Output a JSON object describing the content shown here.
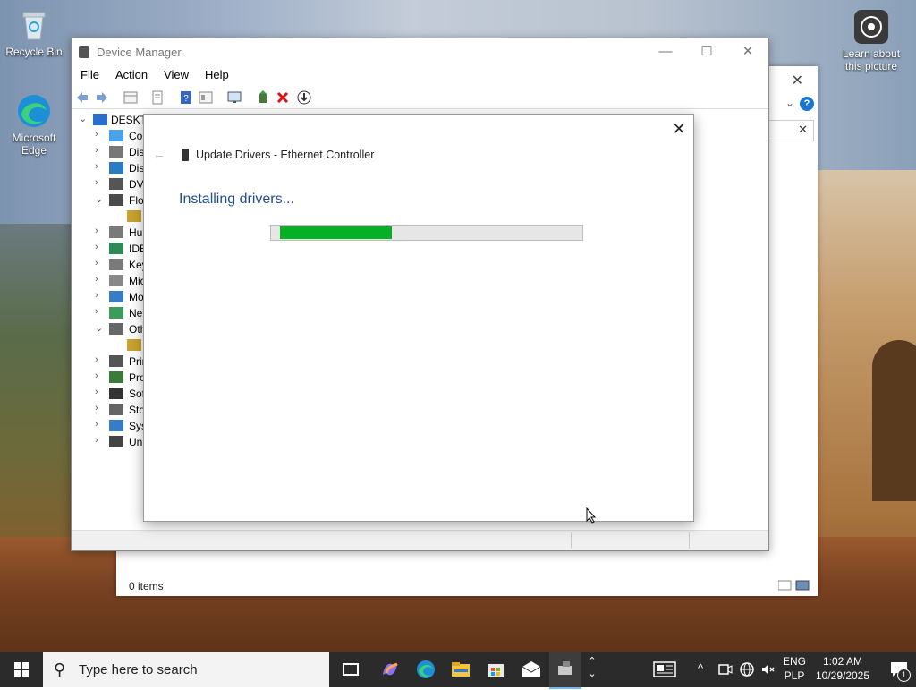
{
  "desktop": {
    "icons": [
      {
        "label": "Recycle Bin"
      },
      {
        "label": "Microsoft Edge"
      },
      {
        "label": "Learn about this picture"
      }
    ]
  },
  "explorer": {
    "status": "0 items"
  },
  "device_manager": {
    "title": "Device Manager",
    "menu": [
      "File",
      "Action",
      "View",
      "Help"
    ],
    "tree": [
      {
        "label": "DESKTO",
        "expanded": true
      },
      {
        "label": "Cor"
      },
      {
        "label": "Disl"
      },
      {
        "label": "Disp"
      },
      {
        "label": "DVD"
      },
      {
        "label": "Flop",
        "expanded": true
      },
      {
        "label": ""
      },
      {
        "label": "Hur"
      },
      {
        "label": "IDE"
      },
      {
        "label": "Key"
      },
      {
        "label": "Mic"
      },
      {
        "label": "Mo"
      },
      {
        "label": "Net"
      },
      {
        "label": "Oth",
        "expanded": true
      },
      {
        "label": ""
      },
      {
        "label": "Prir"
      },
      {
        "label": "Pro"
      },
      {
        "label": "Sof"
      },
      {
        "label": "Sto"
      },
      {
        "label": "Syst"
      },
      {
        "label": "Uni"
      }
    ]
  },
  "dialog": {
    "title": "Update Drivers - Ethernet Controller",
    "heading": "Installing drivers...",
    "progress": 0.37,
    "progress_color": "#06b025"
  },
  "taskbar": {
    "search_placeholder": "Type here to search",
    "language_top": "ENG",
    "language_bottom": "PLP",
    "time": "1:02 AM",
    "date": "10/29/2025",
    "notification_count": "1"
  }
}
